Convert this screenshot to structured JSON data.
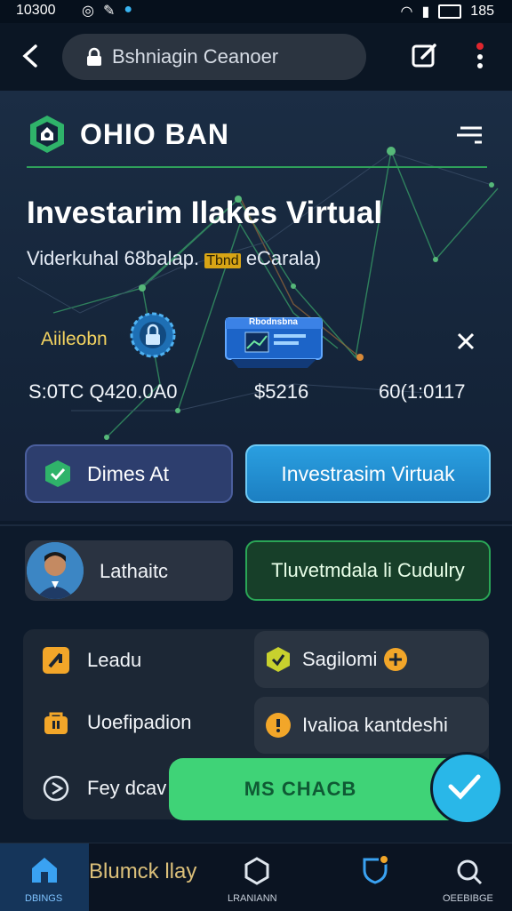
{
  "status_bar": {
    "time": "10300",
    "battery": "185"
  },
  "browser": {
    "url_text": "Bshniagin Ceanoer"
  },
  "brand": {
    "name": "OHIO BAN"
  },
  "hero": {
    "title": "Investarim Ilakes Virtual",
    "subtitle_prefix": "Viderkuhal 68balap.",
    "subtitle_tag": "Tbnd",
    "subtitle_suffix": "eCarala)",
    "feature_label": "Aiileobn",
    "card_label": "Rbodnsbna",
    "stats": [
      "S:0TC Q420.0A0",
      "$5216",
      "60(1:0117"
    ]
  },
  "buttons": {
    "primary": "Dimes At",
    "secondary": "Investrasim Virtuak"
  },
  "profile": {
    "label": "Lathaitc"
  },
  "green_button": "Tluvetmdala  li Cudulry",
  "list": {
    "left": [
      "Leadu",
      "Uoefipadion",
      "Fey dcav"
    ],
    "right": [
      "Sagilomi",
      "Ivalioa kantdeshi"
    ]
  },
  "fab": {
    "label": "MS CHACB"
  },
  "bottom_nav": {
    "tabs": [
      "DBINGS",
      "LRANIANN",
      "OEEBIBGE"
    ],
    "promo": "Blumck llay"
  },
  "colors": {
    "accent_blue": "#29b7e8",
    "accent_green": "#3fd377",
    "background": "#0d1a2b"
  }
}
